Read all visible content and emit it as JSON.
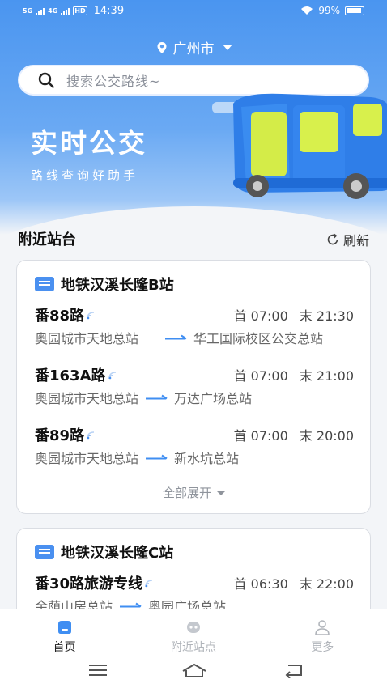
{
  "status_bar": {
    "signal1": "5G",
    "signal2": "4G",
    "hd": "HD",
    "time": "14:39",
    "battery": "99%"
  },
  "header": {
    "city": "广州市",
    "search_placeholder": "搜索公交路线~",
    "slogan": "实时公交",
    "subslogan": "路线查询好助手"
  },
  "nearby": {
    "title": "附近站台",
    "refresh_label": "刷新"
  },
  "stations": [
    {
      "name": "地铁汉溪长隆B站",
      "routes": [
        {
          "name": "番88路",
          "first": "首 07:00",
          "last": "末 21:30",
          "from": "奥园城市天地总站",
          "to": "华工国际校区公交总站"
        },
        {
          "name": "番163A路",
          "first": "首 07:00",
          "last": "末 21:00",
          "from": "奥园城市天地总站",
          "to": "万达广场总站"
        },
        {
          "name": "番89路",
          "first": "首 07:00",
          "last": "末 20:00",
          "from": "奥园城市天地总站",
          "to": "新水坑总站"
        }
      ],
      "expand_label": "全部展开"
    },
    {
      "name": "地铁汉溪长隆C站",
      "routes": [
        {
          "name": "番30路旅游专线",
          "first": "首 06:30",
          "last": "末 22:00",
          "from": "余荫山房总站",
          "to": "奥园广场总站"
        }
      ]
    }
  ],
  "tabbar": {
    "items": [
      {
        "label": "首页",
        "icon": "home-icon",
        "active": true
      },
      {
        "label": "附近站点",
        "icon": "nearby-icon",
        "active": false
      },
      {
        "label": "更多",
        "icon": "user-icon",
        "active": false
      }
    ]
  },
  "colors": {
    "accent": "#3f8ef2",
    "banner_top": "#4a95f0"
  }
}
